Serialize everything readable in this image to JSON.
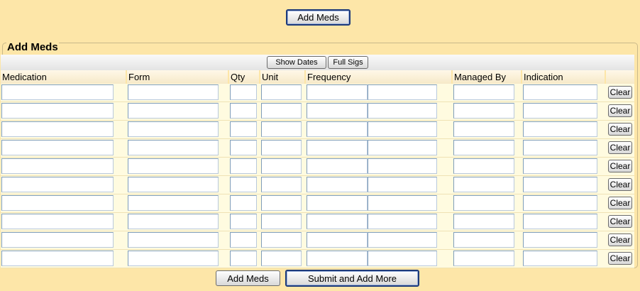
{
  "top_button": {
    "label": "Add Meds"
  },
  "section": {
    "legend": "Add Meds"
  },
  "toolbar": {
    "show_dates": "Show Dates",
    "full_sigs": "Full Sigs"
  },
  "columns": {
    "medication": "Medication",
    "form": "Form",
    "qty": "Qty",
    "unit": "Unit",
    "frequency": "Frequency",
    "managed_by": "Managed By",
    "indication": "Indication"
  },
  "rows": [
    {
      "medication": "",
      "form": "",
      "qty": "",
      "unit": "",
      "freq1": "",
      "freq2": "",
      "managed_by": "",
      "indication": "",
      "clear_label": "Clear"
    },
    {
      "medication": "",
      "form": "",
      "qty": "",
      "unit": "",
      "freq1": "",
      "freq2": "",
      "managed_by": "",
      "indication": "",
      "clear_label": "Clear"
    },
    {
      "medication": "",
      "form": "",
      "qty": "",
      "unit": "",
      "freq1": "",
      "freq2": "",
      "managed_by": "",
      "indication": "",
      "clear_label": "Clear"
    },
    {
      "medication": "",
      "form": "",
      "qty": "",
      "unit": "",
      "freq1": "",
      "freq2": "",
      "managed_by": "",
      "indication": "",
      "clear_label": "Clear"
    },
    {
      "medication": "",
      "form": "",
      "qty": "",
      "unit": "",
      "freq1": "",
      "freq2": "",
      "managed_by": "",
      "indication": "",
      "clear_label": "Clear"
    },
    {
      "medication": "",
      "form": "",
      "qty": "",
      "unit": "",
      "freq1": "",
      "freq2": "",
      "managed_by": "",
      "indication": "",
      "clear_label": "Clear"
    },
    {
      "medication": "",
      "form": "",
      "qty": "",
      "unit": "",
      "freq1": "",
      "freq2": "",
      "managed_by": "",
      "indication": "",
      "clear_label": "Clear"
    },
    {
      "medication": "",
      "form": "",
      "qty": "",
      "unit": "",
      "freq1": "",
      "freq2": "",
      "managed_by": "",
      "indication": "",
      "clear_label": "Clear"
    },
    {
      "medication": "",
      "form": "",
      "qty": "",
      "unit": "",
      "freq1": "",
      "freq2": "",
      "managed_by": "",
      "indication": "",
      "clear_label": "Clear"
    },
    {
      "medication": "",
      "form": "",
      "qty": "",
      "unit": "",
      "freq1": "",
      "freq2": "",
      "managed_by": "",
      "indication": "",
      "clear_label": "Clear"
    }
  ],
  "footer": {
    "add_meds": "Add Meds",
    "submit_add_more": "Submit and Add More"
  },
  "colors": {
    "page_bg": "#fde6a8",
    "row_bg": "#fffbe0",
    "input_border": "#7f9db9",
    "focus_border": "#1d3a7a"
  }
}
